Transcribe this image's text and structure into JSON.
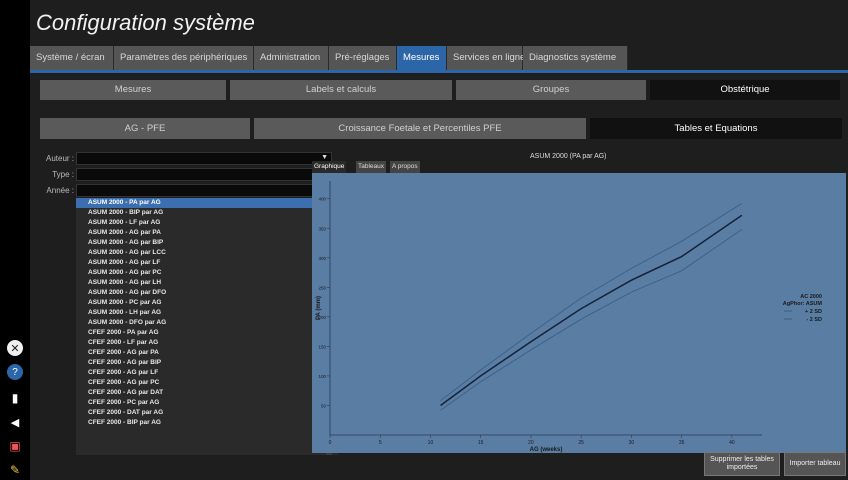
{
  "title": "Configuration système",
  "main_tabs": [
    {
      "label": "Système / écran"
    },
    {
      "label": "Paramètres des périphériques"
    },
    {
      "label": "Administration"
    },
    {
      "label": "Pré-réglages"
    },
    {
      "label": "Mesures",
      "active": true
    },
    {
      "label": "Services en ligne"
    },
    {
      "label": "Diagnostics système"
    }
  ],
  "sub_tabs": [
    {
      "label": "Mesures"
    },
    {
      "label": "Labels et calculs"
    },
    {
      "label": "Groupes"
    },
    {
      "label": "Obstétrique",
      "active": true
    }
  ],
  "obs_tabs": [
    {
      "label": "AG - PFE"
    },
    {
      "label": "Croissance Foetale et Percentiles PFE"
    },
    {
      "label": "Tables et Equations",
      "active": true
    }
  ],
  "filters": [
    {
      "label": "Auteur :",
      "value": ""
    },
    {
      "label": "Type :",
      "value": ""
    },
    {
      "label": "Année :",
      "value": ""
    }
  ],
  "tables": [
    "ASUM 2000 - PA par AG",
    "ASUM 2000 - BIP par AG",
    "ASUM 2000 - LF par AG",
    "ASUM 2000 - AG par PA",
    "ASUM 2000 - AG par BIP",
    "ASUM 2000 - AG par LCC",
    "ASUM 2000 - AG par LF",
    "ASUM 2000 - AG par PC",
    "ASUM 2000 - AG par LH",
    "ASUM 2000 - AG par DFO",
    "ASUM 2000 - PC par AG",
    "ASUM 2000 - LH par AG",
    "ASUM 2000 - DFO par AG",
    "CFEF 2000 - PA par AG",
    "CFEF 2000 - LF par AG",
    "CFEF 2000 - AG par PA",
    "CFEF 2000 - AG par BIP",
    "CFEF 2000 - AG par LF",
    "CFEF 2000 - AG par PC",
    "CFEF 2000 - AG par DAT",
    "CFEF 2000 - PC par AG",
    "CFEF 2000 - DAT par AG",
    "CFEF 2000 - BIP par AG"
  ],
  "selected_table": "ASUM 2000 - PA par AG",
  "chart_panel": {
    "title": "ASUM 2000 (PA par AG)",
    "tabs": [
      {
        "label": "Graphique",
        "active": true
      },
      {
        "label": "Tableaux"
      },
      {
        "label": "A propos"
      }
    ]
  },
  "chart_data": {
    "type": "line",
    "title": "",
    "xlabel": "AG (weeks)",
    "ylabel": "PA (mm)",
    "xlim": [
      0,
      43
    ],
    "ylim": [
      0,
      430
    ],
    "xticks": [
      0,
      5,
      10,
      15,
      20,
      25,
      30,
      35,
      40
    ],
    "yticks": [
      50,
      100,
      150,
      200,
      250,
      300,
      350,
      400
    ],
    "grid": false,
    "background": "#5a7da3",
    "legend_title": [
      "AC 2000",
      "AgPhor: ASUM"
    ],
    "legend_position": "right",
    "series": [
      {
        "name": "",
        "color": "#14233a",
        "x": [
          11,
          15,
          20,
          25,
          30,
          35,
          41
        ],
        "y": [
          50,
          100,
          158,
          214,
          262,
          302,
          372
        ]
      },
      {
        "name": "+ 2 SD",
        "color": "#3d5f86",
        "x": [
          11,
          15,
          20,
          25,
          30,
          35,
          41
        ],
        "y": [
          58,
          110,
          172,
          232,
          282,
          328,
          392
        ]
      },
      {
        "name": "- 2 SD",
        "color": "#3d5f86",
        "x": [
          11,
          15,
          20,
          25,
          30,
          35,
          41
        ],
        "y": [
          42,
          90,
          144,
          196,
          242,
          278,
          348
        ]
      }
    ]
  },
  "buttons": {
    "delete_imported": "Supprimer les tables importées",
    "import_table": "Importer tableau"
  },
  "side_icons": [
    "close-circle-icon",
    "help-circle-icon",
    "mouse-icon",
    "speaker-icon",
    "print-icon",
    "pen-icon"
  ]
}
